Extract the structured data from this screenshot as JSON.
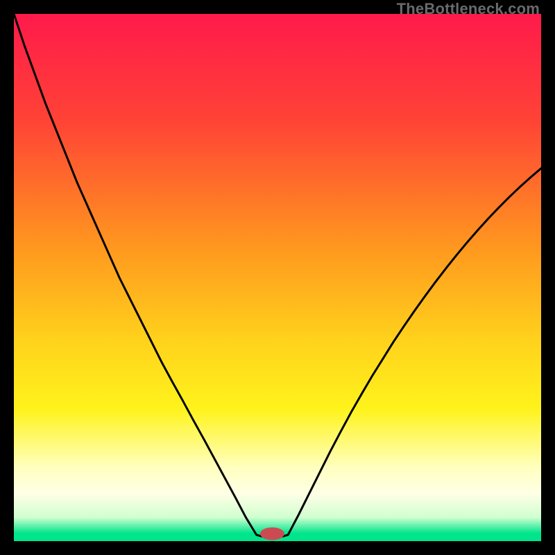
{
  "watermark": "TheBottleneck.com",
  "chart_data": {
    "type": "line",
    "title": "",
    "xlabel": "",
    "ylabel": "",
    "xlim": [
      0,
      100
    ],
    "ylim": [
      0,
      100
    ],
    "gradient_stops": [
      {
        "offset": 0.0,
        "color": "#ff1a4b"
      },
      {
        "offset": 0.2,
        "color": "#ff4236"
      },
      {
        "offset": 0.45,
        "color": "#ff9a1e"
      },
      {
        "offset": 0.62,
        "color": "#ffd21c"
      },
      {
        "offset": 0.75,
        "color": "#fff31c"
      },
      {
        "offset": 0.86,
        "color": "#ffffbf"
      },
      {
        "offset": 0.91,
        "color": "#ffffe6"
      },
      {
        "offset": 0.955,
        "color": "#d0ffd0"
      },
      {
        "offset": 0.985,
        "color": "#00e58b"
      },
      {
        "offset": 1.0,
        "color": "#00e58b"
      }
    ],
    "series": [
      {
        "name": "left-curve",
        "x": [
          0.0,
          2,
          4,
          6,
          8,
          10,
          12,
          14,
          16,
          18,
          20,
          22,
          24,
          26,
          28,
          30,
          32,
          34,
          36,
          38,
          40,
          42,
          44,
          46
        ],
        "y": [
          100,
          94,
          88.5,
          83,
          78,
          73,
          68,
          63.5,
          59,
          54.5,
          50,
          46,
          42,
          38,
          34,
          30.3,
          26.7,
          23,
          19.4,
          15.7,
          12,
          8.3,
          4.5,
          1.2
        ]
      },
      {
        "name": "valley-flat",
        "x": [
          46,
          47,
          48,
          49,
          50,
          51,
          52
        ],
        "y": [
          1.2,
          0.9,
          0.8,
          0.8,
          0.8,
          0.9,
          1.2
        ]
      },
      {
        "name": "right-curve",
        "x": [
          52,
          54,
          56,
          58,
          60,
          62,
          64,
          66,
          68,
          70,
          72,
          74,
          76,
          78,
          80,
          82,
          84,
          86,
          88,
          90,
          92,
          94,
          96,
          98,
          100
        ],
        "y": [
          1.2,
          5,
          9,
          13,
          17,
          20.8,
          24.5,
          28,
          31.4,
          34.6,
          37.8,
          40.8,
          43.7,
          46.5,
          49.2,
          51.8,
          54.3,
          56.7,
          59,
          61.2,
          63.3,
          65.3,
          67.2,
          69,
          70.7
        ]
      }
    ],
    "marker": {
      "name": "bottleneck-marker",
      "cx": 49,
      "cy": 1.4,
      "rx": 2.3,
      "ry": 1.2,
      "fill": "#cc4b52"
    },
    "curve_stroke": "#000000",
    "curve_width": 3
  }
}
